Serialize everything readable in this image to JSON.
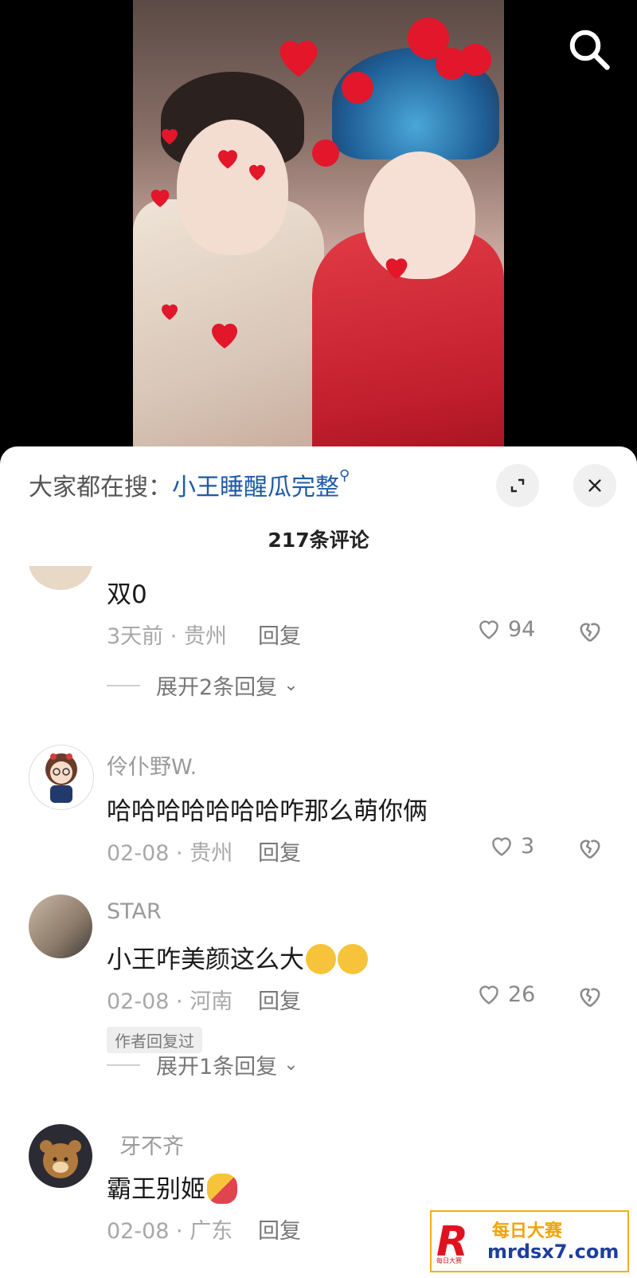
{
  "search_hint": {
    "prefix": "大家都在搜：",
    "keyword": "小王睡醒瓜完整"
  },
  "comments_count": "217条评论",
  "comments": [
    {
      "username": "",
      "text": "双0",
      "time": "3天前",
      "location": "贵州",
      "reply_label": "回复",
      "likes": "94",
      "expand_label": "展开2条回复"
    },
    {
      "username": "伶仆野W.",
      "text": "哈哈哈哈哈哈哈咋那么萌你俩",
      "time": "02-08",
      "location": "贵州",
      "reply_label": "回复",
      "likes": "3"
    },
    {
      "username": "STAR",
      "text": "小王咋美颜这么大",
      "time": "02-08",
      "location": "河南",
      "reply_label": "回复",
      "likes": "26",
      "badge": "作者回复过",
      "expand_label": "展开1条回复"
    },
    {
      "username": "牙不齐",
      "text": "霸王别姬",
      "time": "02-08",
      "location": "广东",
      "reply_label": "回复",
      "likes": ""
    }
  ],
  "watermark": {
    "logo": "R",
    "title": "每日大赛",
    "url": "mrdsx7.com",
    "sub": "每日大赛"
  },
  "colors": {
    "accent": "#1e5aa8",
    "heart": "#e3162a",
    "sheet_bg": "#ffffff"
  }
}
